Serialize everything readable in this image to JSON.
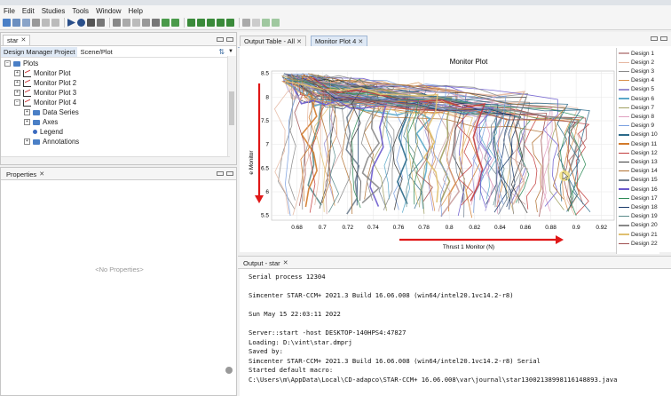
{
  "menu": [
    "File",
    "Edit",
    "Studies",
    "Tools",
    "Window",
    "Help"
  ],
  "left_top_panel": {
    "tab_label": "star",
    "subtabs": [
      "Design Manager Project",
      "Scene/Plot"
    ],
    "tree": [
      {
        "label": "Plots",
        "level": 0,
        "icon": "folder-icon"
      },
      {
        "label": "Monitor Plot",
        "level": 1,
        "icon": "plot-icon"
      },
      {
        "label": "Monitor Plot 2",
        "level": 1,
        "icon": "plot-icon"
      },
      {
        "label": "Monitor Plot 3",
        "level": 1,
        "icon": "plot-icon"
      },
      {
        "label": "Monitor Plot 4",
        "level": 1,
        "icon": "plot-icon"
      },
      {
        "label": "Data Series",
        "level": 2,
        "icon": "folder-icon"
      },
      {
        "label": "Axes",
        "level": 2,
        "icon": "folder-icon"
      },
      {
        "label": "Legend",
        "level": 2,
        "icon": "dot-icon"
      },
      {
        "label": "Annotations",
        "level": 2,
        "icon": "folder-icon"
      }
    ]
  },
  "properties_panel": {
    "tab_label": "Properties",
    "empty_text": "<No Properties>"
  },
  "plot_tabs": [
    "Output Table - All",
    "Monitor Plot 4"
  ],
  "chart_data": {
    "type": "line",
    "title": "Monitor Plot",
    "xlabel": "Thrust 1 Monitor (N)",
    "ylabel": "e Monitor",
    "xlim": [
      0.66,
      0.93
    ],
    "ylim": [
      5.4,
      8.55
    ],
    "x_ticks": [
      "0.68",
      "0.7",
      "0.72",
      "0.74",
      "0.76",
      "0.78",
      "0.8",
      "0.82",
      "0.84",
      "0.86",
      "0.88",
      "0.9",
      "0.92"
    ],
    "y_ticks": [
      "5.5",
      "6",
      "6.5",
      "7",
      "7.5",
      "8",
      "8.5"
    ],
    "legend_position": "right",
    "series": [
      {
        "name": "Design 1",
        "color": "#c9a0a0"
      },
      {
        "name": "Design 2",
        "color": "#e6b8a2"
      },
      {
        "name": "Design 3",
        "color": "#8a8a8a"
      },
      {
        "name": "Design 4",
        "color": "#d9904a"
      },
      {
        "name": "Design 5",
        "color": "#9a8fd0"
      },
      {
        "name": "Design 6",
        "color": "#5aa8c9"
      },
      {
        "name": "Design 7",
        "color": "#a0a060"
      },
      {
        "name": "Design 8",
        "color": "#e0a0c0"
      },
      {
        "name": "Design 9",
        "color": "#7aa0e0"
      },
      {
        "name": "Design 10",
        "color": "#2b6a8a"
      },
      {
        "name": "Design 11",
        "color": "#d27a2a"
      },
      {
        "name": "Design 12",
        "color": "#c23d3d"
      },
      {
        "name": "Design 13",
        "color": "#3a3a3a"
      },
      {
        "name": "Design 14",
        "color": "#b07030"
      },
      {
        "name": "Design 15",
        "color": "#708090"
      },
      {
        "name": "Design 16",
        "color": "#6a5acd"
      },
      {
        "name": "Design 17",
        "color": "#2e8b57"
      },
      {
        "name": "Design 18",
        "color": "#1a3a6a"
      },
      {
        "name": "Design 19",
        "color": "#5a8a8a"
      },
      {
        "name": "Design 20",
        "color": "#888888"
      },
      {
        "name": "Design 21",
        "color": "#e0c070"
      },
      {
        "name": "Design 22",
        "color": "#a05050"
      }
    ],
    "annotations": [
      "red arrow along y axis pointing down",
      "red arrow along x axis pointing right"
    ]
  },
  "output_panel": {
    "tab_label": "Output - star",
    "lines": [
      "Serial process 12304",
      "",
      "Simcenter STAR-CCM+ 2021.3 Build 16.06.008 (win64/intel20.1vc14.2-r8)",
      "",
      "Sun May 15 22:03:11 2022",
      "",
      "Server::start -host DESKTOP-140HPS4:47827",
      "Loading: D:\\vint\\star.dmprj",
      "Saved by:",
      "  Simcenter STAR-CCM+ 2021.3 Build 16.06.008 (win64/intel20.1vc14.2-r8) Serial",
      "Started default macro:",
      "C:\\Users\\m\\AppData\\Local\\CD-adapco\\STAR-CCM+ 16.06.008\\var\\journal\\star13002138998116148893.java"
    ]
  }
}
